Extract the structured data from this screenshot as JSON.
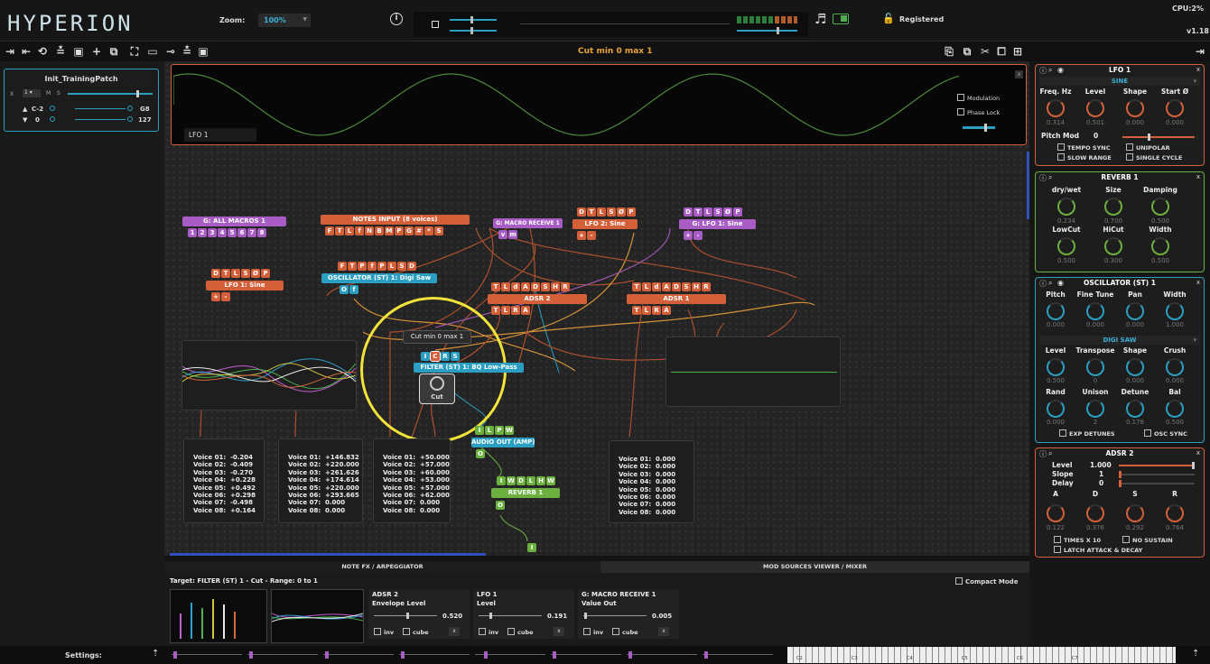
{
  "app": {
    "logo": "HYPERION",
    "zoom_label": "Zoom:",
    "zoom_value": "100%",
    "registered": "Registered",
    "cpu": "CPU:2%",
    "version": "v1.18"
  },
  "toolbar": {
    "status": "Cut  min 0 max 1"
  },
  "patch": {
    "name": "Init_TrainingPatch",
    "ch_label": "X",
    "ch_value": "1",
    "m": "M",
    "s": "S",
    "low_note": "C-2",
    "high_note": "G8",
    "low_vel": "0",
    "high_vel": "127"
  },
  "lfo_display": {
    "label": "LFO 1",
    "modulation": "Modulation",
    "phase_lock": "Phase Lock",
    "close": "x"
  },
  "nodes": {
    "all_macros": "G: ALL MACROS 1",
    "notes_input": "NOTES INPUT  (8 voices)",
    "macro_receive": "G: MACRO RECEIVE 1",
    "lfo2": "LFO 2: Sine",
    "glfo1": "G: LFO 1: Sine",
    "lfo1": "LFO 1: Sine",
    "osc": "OSCILLATOR (ST) 1: Digi Saw",
    "adsr2": "ADSR 2",
    "adsr1": "ADSR 1",
    "filter": "FILTER (ST) 1: BQ Low-Pass",
    "audio_out": "AUDIO OUT (AMP)",
    "reverb": "REVERB 1",
    "tooltip": "Cut  min 0 max 1",
    "cut_knob": "Cut"
  },
  "pins": {
    "macros": [
      "1",
      "2",
      "3",
      "4",
      "5",
      "6",
      "7",
      "8"
    ],
    "notes": [
      "F",
      "T",
      "L",
      "f",
      "N",
      "B",
      "M",
      "P",
      "G",
      "#",
      "*",
      "S"
    ],
    "macro_recv": [
      "v",
      "m"
    ],
    "lfo_ctl": [
      "D",
      "T",
      "L",
      "S",
      "Ø",
      "P"
    ],
    "plus_minus": [
      "+",
      "-"
    ],
    "osc_in": [
      "F",
      "T",
      "P",
      "f",
      "P",
      "L",
      "S",
      "D"
    ],
    "osc_out": [
      "O",
      "f"
    ],
    "adsr_in": [
      "T",
      "L",
      "d",
      "A",
      "D",
      "S",
      "H",
      "R"
    ],
    "adsr_out": [
      "T",
      "L",
      "R",
      "A"
    ],
    "filter_in": [
      "I",
      "C",
      "R",
      "S"
    ],
    "audio_in": [
      "I",
      "L",
      "P",
      "W"
    ],
    "reverb_in": [
      "I",
      "W",
      "D",
      "L",
      "H",
      "W"
    ],
    "out": "O",
    "in": "I"
  },
  "voice_lists": [
    "Voice 01:  -0.204\nVoice 02:  -0.409\nVoice 03:  -0.270\nVoice 04:  +0.228\nVoice 05:  +0.492\nVoice 06:  +0.298\nVoice 07:  -0.498\nVoice 08:  +0.164",
    "Voice 01:  +146.832\nVoice 02:  +220.000\nVoice 03:  +261.626\nVoice 04:  +174.614\nVoice 05:  +220.000\nVoice 06:  +293.665\nVoice 07:  0.000\nVoice 08:  0.000",
    "Voice 01:  +50.000\nVoice 02:  +57.000\nVoice 03:  +60.000\nVoice 04:  +53.000\nVoice 05:  +57.000\nVoice 06:  +62.000\nVoice 07:  0.000\nVoice 08:  0.000",
    "Voice 01:  0.000\nVoice 02:  0.000\nVoice 03:  0.000\nVoice 04:  0.000\nVoice 05:  0.000\nVoice 06:  0.000\nVoice 07:  0.000\nVoice 08:  0.000"
  ],
  "tabs": {
    "note_fx": "NOTE FX / ARPEGGIATOR",
    "mod_sources": "MOD SOURCES VIEWER / MIXER"
  },
  "bottom": {
    "target": "Target: FILTER (ST) 1 - Cut - Range: 0 to 1",
    "compact": "Compact Mode",
    "settings": "Settings:",
    "mods": [
      {
        "title": "ADSR 2",
        "sub": "Envelope Level",
        "value": "0.520"
      },
      {
        "title": "LFO 1",
        "sub": "Level",
        "value": "0.191"
      },
      {
        "title": "G: MACRO RECEIVE 1",
        "sub": "Value Out",
        "value": "0.005"
      }
    ],
    "inv": "inv",
    "cube": "cube",
    "x": "x",
    "keys": [
      "C2",
      "C3",
      "C4",
      "C5",
      "C6",
      "C7"
    ]
  },
  "right": {
    "lfo": {
      "title": "LFO 1",
      "wave": "SINE",
      "labels": [
        "Freq. Hz",
        "Level",
        "Shape",
        "Start Ø"
      ],
      "values": [
        "0.314",
        "0.501",
        "0.000",
        "0.000"
      ],
      "pitch_mod": "Pitch Mod",
      "pitch_val": "0",
      "checks": [
        "TEMPO SYNC",
        "UNIPOLAR",
        "SLOW RANGE",
        "SINGLE CYCLE"
      ],
      "x": "x"
    },
    "reverb": {
      "title": "REVERB 1",
      "labels": [
        "dry/wet",
        "Size",
        "Damping",
        "LowCut",
        "HiCut",
        "Width"
      ],
      "values": [
        "0.234",
        "0.700",
        "0.500",
        "0.500",
        "0.300",
        "0.500"
      ],
      "x": "x"
    },
    "osc": {
      "title": "OSCILLATOR (ST) 1",
      "labels1": [
        "Pitch",
        "Fine Tune",
        "Pan",
        "Width"
      ],
      "values1": [
        "0.000",
        "0.000",
        "0.000",
        "1.000"
      ],
      "wave": "DIGI SAW",
      "labels2": [
        "Level",
        "Transpose",
        "Shape",
        "Crush"
      ],
      "values2": [
        "0.500",
        "0",
        "0.000",
        "0.000"
      ],
      "labels3": [
        "Rand",
        "Unison",
        "Detune",
        "Bal"
      ],
      "values3": [
        "0.000",
        "2",
        "0.178",
        "0.500"
      ],
      "checks": [
        "EXP DETUNES",
        "OSC SYNC"
      ],
      "x": "x"
    },
    "adsr": {
      "title": "ADSR 2",
      "rows": [
        [
          "Level",
          "1.000"
        ],
        [
          "Slope",
          "1"
        ],
        [
          "Delay",
          "0"
        ]
      ],
      "labels": [
        "A",
        "D",
        "S",
        "R"
      ],
      "values": [
        "0.122",
        "0.376",
        "0.292",
        "0.764"
      ],
      "checks": [
        "TIMES X 10",
        "NO SUSTAIN",
        "LATCH ATTACK & DECAY"
      ],
      "x": "x"
    }
  },
  "colors": {
    "orange": "#d4603a",
    "purple": "#a75dc4",
    "blue": "#2b9fc2",
    "green": "#6cb040",
    "highlight": "#f1e33a"
  }
}
